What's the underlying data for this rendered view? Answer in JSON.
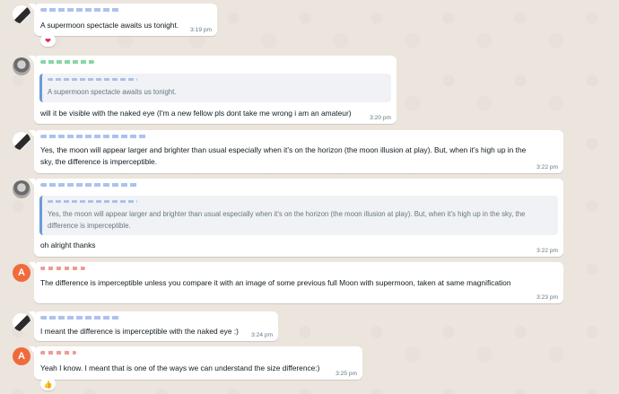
{
  "messages": [
    {
      "id": "m1",
      "avatar": "bw-avatar",
      "text": "A supermoon spectacle awaits us tonight.",
      "time": "3:19 pm",
      "reaction": "❤"
    },
    {
      "id": "m2",
      "avatar": "photo-avatar",
      "quote": "A supermoon spectacle awaits us tonight.",
      "text": "will it be visible with the naked eye (I'm a new fellow pls dont take me wrong i am an amateur)",
      "time": "3:20 pm"
    },
    {
      "id": "m3",
      "avatar": "bw-avatar",
      "text_line1": "Yes, the moon will appear larger and brighter than usual especially when it’s on the horizon (the moon illusion at play). But, when it’s high up in the",
      "text_line2": "sky, the difference is imperceptible.",
      "time": "3:22 pm"
    },
    {
      "id": "m4",
      "avatar": "photo-avatar",
      "quote_line1": "Yes, the moon will appear larger and brighter than usual especially when it’s on the horizon (the moon illusion at play). But, when it’s high up in the sky, the",
      "quote_line2": "difference is imperceptible.",
      "text": "oh alright thanks",
      "time": "3:22 pm"
    },
    {
      "id": "m5",
      "avatar": "A",
      "text": "The difference is imperceptible unless you compare it with an image of some  previous full Moon with supermoon, taken at same magnification",
      "time": "3:23 pm"
    },
    {
      "id": "m6",
      "avatar": "bw-avatar",
      "text": "I meant the difference is imperceptible with the naked eye :)",
      "time": "3:24 pm"
    },
    {
      "id": "m7",
      "avatar": "A",
      "text": "Yeah I know. I meant that is one of the ways we can understand the size difference:)",
      "time": "3:25 pm",
      "reaction": "👍"
    }
  ]
}
